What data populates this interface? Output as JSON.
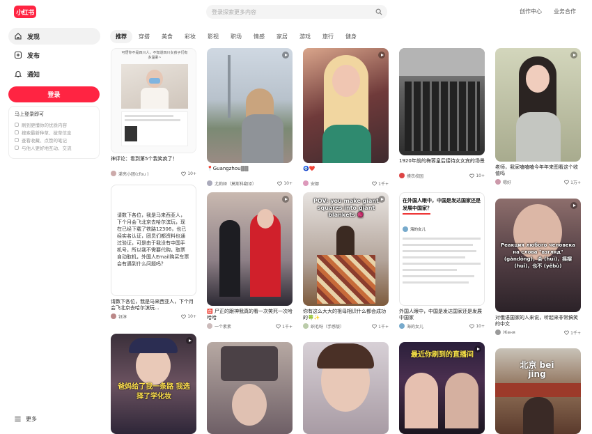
{
  "header": {
    "logo": "小红书",
    "search_placeholder": "登录探索更多内容",
    "links": [
      "创作中心",
      "业务合作"
    ]
  },
  "sidebar": {
    "items": [
      {
        "label": "发现",
        "icon": "home-icon"
      },
      {
        "label": "发布",
        "icon": "plus-square-icon"
      },
      {
        "label": "通知",
        "icon": "bell-icon"
      }
    ],
    "login_label": "登录",
    "login_card": {
      "title": "马上登录即可",
      "lines": [
        "刷到更懂你的优质内容",
        "搜索最新种草、拔草信息",
        "查看收藏、点赞的笔记",
        "与他人更好地互动、交流"
      ]
    },
    "more_label": "更多"
  },
  "tabs": [
    "推荐",
    "穿搭",
    "美食",
    "彩妆",
    "影视",
    "职场",
    "情感",
    "家居",
    "游戏",
    "旅行",
    "健身"
  ],
  "cards": [
    {
      "title": "神评论：看到第5个我笑疯了！",
      "author": "漾亮小团(cfou )",
      "likes": "10+",
      "thumb_text": "可悟你不是四川人，不知道四川女孩子们有多温柔~"
    },
    {
      "title": "📍Guangzhou🀫🀫",
      "author": "尤莉娅（莫斯科翻译）",
      "likes": "10+",
      "thumb_text": ""
    },
    {
      "title": "🧿❤️",
      "author": "安娜",
      "likes": "1千+",
      "thumb_text": ""
    },
    {
      "title": "1920年前的梅蓉皇后接待女女宾的场景",
      "author": "摸衣校园",
      "likes": "10+",
      "thumb_text": ""
    },
    {
      "title": "老师，我家嗑嗑嗑今年年来图看这个收值吗",
      "author": "嗯好",
      "likes": "1万+",
      "thumb_text": ""
    },
    {
      "title": "请数下各位，我是马来西亚人，下个月会飞北京去哈尔滨玩...",
      "author": "钰淳",
      "likes": "10+",
      "thumb_text": "请数下各位，我是马来西亚人，下个月会飞北京去哈尔滨玩，现在已经下载了铁路12306，也已经实名认证，团员们都资料也通过验证，可是由于我没有中国手机号，所以我不需要代购，取票自动取机，外国人Email购买车票会有遇到什么问题吗？"
    },
    {
      "title": "🈴 尸正的跟神我真的看一次笑死一次哈哈哈",
      "author": "一个素素",
      "likes": "1千+",
      "thumb_text": ""
    },
    {
      "title": "你有这么大大的祖母相识什么都会成功的🍀✨",
      "author": "织毛呀（手感版）",
      "likes": "1千+",
      "thumb_text": "POV: you make giant squares into giant blankets 🧶"
    },
    {
      "title": "外国人眼中，中国是发达国家还是发展中国家",
      "author": "海的女儿",
      "likes": "10+",
      "thumb_text": "在外国人眼中，中国是发达国家还是发展中国家？"
    },
    {
      "title": "对俄语国家的人来说，听起来非常搞笑的中文",
      "author": "Женя",
      "likes": "1千+",
      "thumb_text": "Реакция любого человека на слова \"взгляд\" (gàndòng)，会 (huì)，摇摆 (huǐ)，也不 (yěbù)"
    },
    {
      "title": "",
      "author": "",
      "likes": "",
      "thumb_text": "爸妈给了我一条路 我选择了学化妆"
    },
    {
      "title": "",
      "author": "",
      "likes": "",
      "thumb_text": ""
    },
    {
      "title": "",
      "author": "",
      "likes": "",
      "thumb_text": ""
    },
    {
      "title": "",
      "author": "",
      "likes": "",
      "thumb_text": "最近你刷到的直播间"
    },
    {
      "title": "",
      "author": "",
      "likes": "",
      "thumb_text": "北京 bei jing"
    }
  ],
  "card_login_sub": "海的女儿",
  "colors": {
    "brand": "#ff2442"
  }
}
